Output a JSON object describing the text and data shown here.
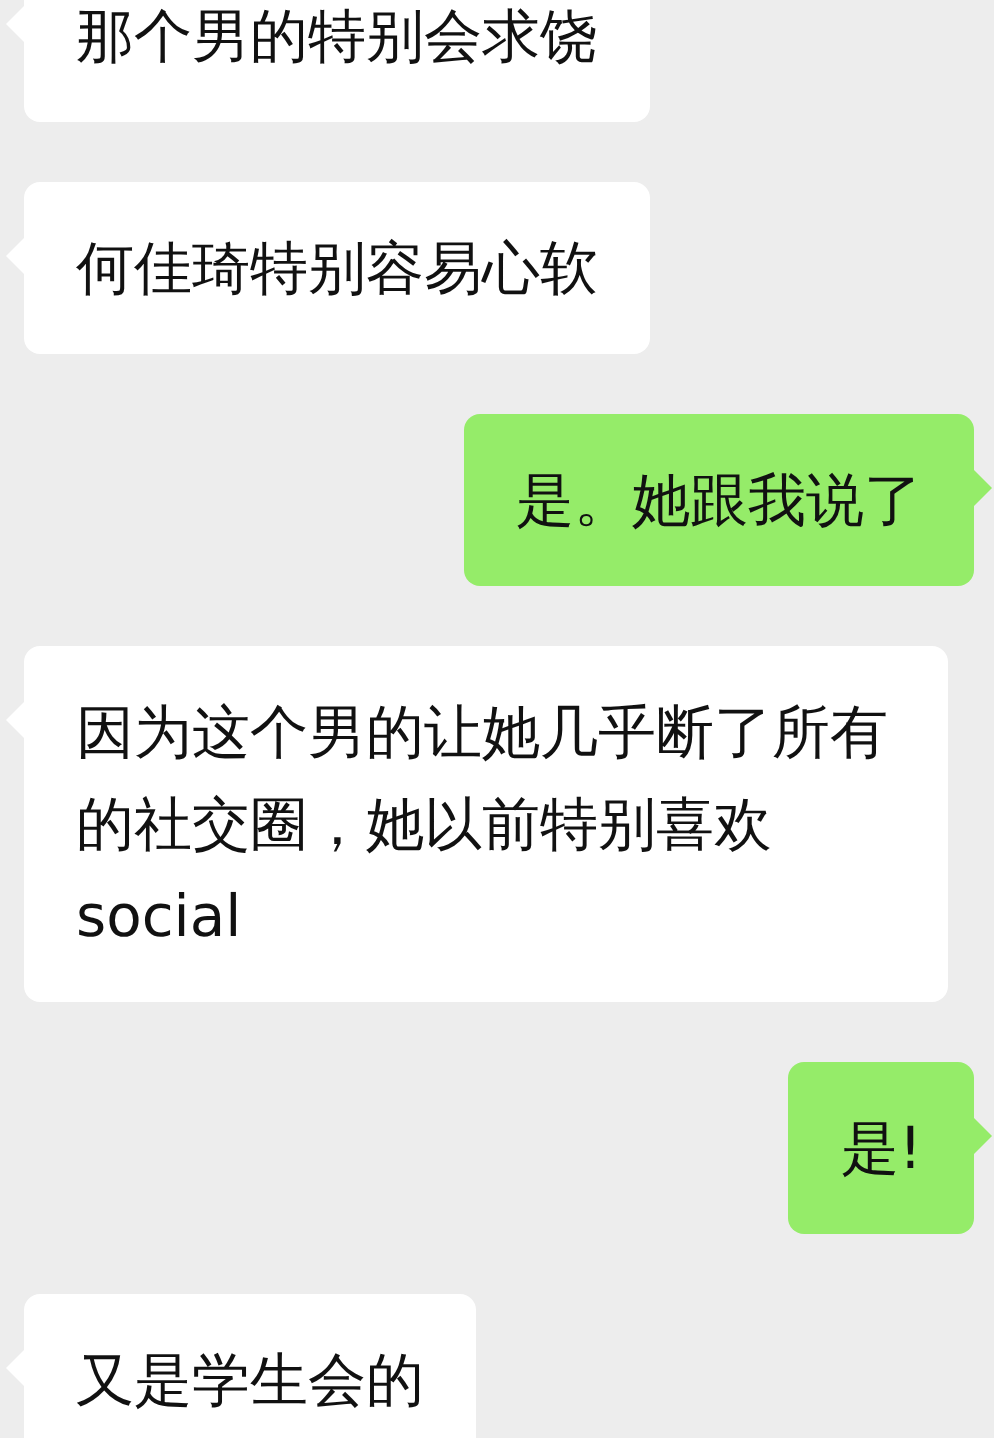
{
  "messages": [
    {
      "kind": "received",
      "text": "那个男的特别会求饶"
    },
    {
      "kind": "received",
      "text": "何佳琦特别容易心软"
    },
    {
      "kind": "sent",
      "text": "是。她跟我说了"
    },
    {
      "kind": "received",
      "text": "因为这个男的让她几乎断了所有的社交圈，她以前特别喜欢social"
    },
    {
      "kind": "sent",
      "text": "是!"
    },
    {
      "kind": "received",
      "text": "又是学生会的"
    }
  ]
}
